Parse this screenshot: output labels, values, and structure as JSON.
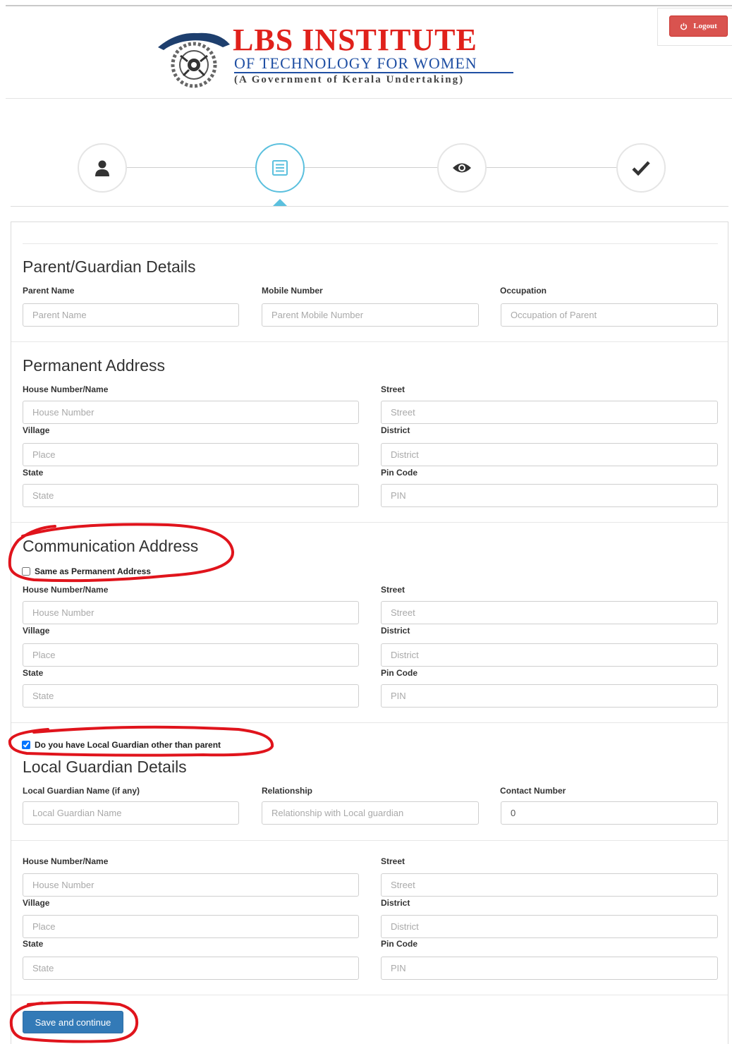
{
  "header": {
    "brand_title": "LBS INSTITUTE",
    "brand_subtitle": "OF TECHNOLOGY FOR WOMEN",
    "brand_tagline": "(A Government of Kerala Undertaking)",
    "logout_label": "Logout"
  },
  "wizard": {
    "steps": [
      {
        "icon": "user-icon",
        "state": "done"
      },
      {
        "icon": "form-list-icon",
        "state": "active"
      },
      {
        "icon": "eye-icon",
        "state": "pending"
      },
      {
        "icon": "check-icon",
        "state": "pending"
      }
    ]
  },
  "parent": {
    "title": "Parent/Guardian Details",
    "name_label": "Parent Name",
    "name_placeholder": "Parent Name",
    "mobile_label": "Mobile Number",
    "mobile_placeholder": "Parent Mobile Number",
    "occupation_label": "Occupation",
    "occupation_placeholder": "Occupation of Parent"
  },
  "permanent": {
    "title": "Permanent Address",
    "house_label": "House Number/Name",
    "house_placeholder": "House Number",
    "street_label": "Street",
    "street_placeholder": "Street",
    "village_label": "Village",
    "village_placeholder": "Place",
    "district_label": "District",
    "district_placeholder": "District",
    "state_label": "State",
    "state_placeholder": "State",
    "pin_label": "Pin Code",
    "pin_placeholder": "PIN"
  },
  "communication": {
    "title": "Communication Address",
    "same_label": "Same as Permanent Address",
    "same_checked": false,
    "house_label": "House Number/Name",
    "house_placeholder": "House Number",
    "street_label": "Street",
    "street_placeholder": "Street",
    "village_label": "Village",
    "village_placeholder": "Place",
    "district_label": "District",
    "district_placeholder": "District",
    "state_label": "State",
    "state_placeholder": "State",
    "pin_label": "Pin Code",
    "pin_placeholder": "PIN"
  },
  "local_guardian": {
    "toggle_label": "Do you have Local Guardian other than parent",
    "toggle_checked": true,
    "title": "Local Guardian Details",
    "name_label": "Local Guardian Name (if any)",
    "name_placeholder": "Local Guardian Name",
    "relation_label": "Relationship",
    "relation_placeholder": "Relationship with Local guardian",
    "contact_label": "Contact Number",
    "contact_value": "0",
    "house_label": "House Number/Name",
    "house_placeholder": "House Number",
    "street_label": "Street",
    "street_placeholder": "Street",
    "village_label": "Village",
    "village_placeholder": "Place",
    "district_label": "District",
    "district_placeholder": "District",
    "state_label": "State",
    "state_placeholder": "State",
    "pin_label": "Pin Code",
    "pin_placeholder": "PIN"
  },
  "actions": {
    "save_label": "Save and continue"
  },
  "colors": {
    "brand_red": "#e0211b",
    "brand_blue": "#1f4fa3",
    "primary": "#337ab7",
    "danger": "#d9534f",
    "annotation": "#e0141c",
    "wizard_active": "#5bc0de"
  }
}
